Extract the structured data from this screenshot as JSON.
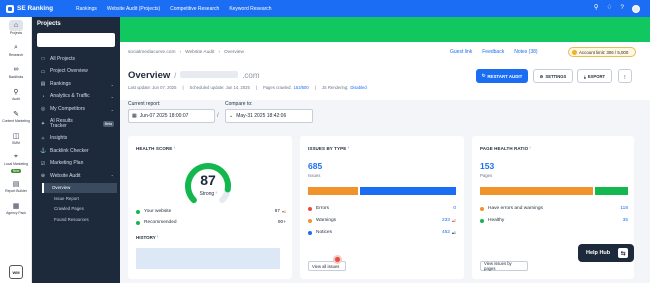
{
  "topbar": {
    "brand": "SE Ranking",
    "nav": [
      "Rankings",
      "Website Audit (Projects)",
      "Competitive Research",
      "Keyword Research"
    ],
    "icons": [
      "location-icon",
      "bell-icon",
      "help-icon",
      "avatar"
    ]
  },
  "rail": [
    {
      "icon": "home-icon",
      "label": "Projects",
      "active": true
    },
    {
      "icon": "search-icon",
      "label": "Research"
    },
    {
      "icon": "link-icon",
      "label": "Backlinks"
    },
    {
      "icon": "magnifier-icon",
      "label": "Audit"
    },
    {
      "icon": "pencil-icon",
      "label": "Content Marketing"
    },
    {
      "icon": "bag-icon",
      "label": "SMM"
    },
    {
      "icon": "pin-icon",
      "label": "Local Marketing",
      "badge": "New"
    },
    {
      "icon": "report-icon",
      "label": "Report Builder"
    },
    {
      "icon": "agency-icon",
      "label": "Agency Pack"
    }
  ],
  "rail_watermark": "WM",
  "projects_panel": {
    "title": "Projects",
    "items": [
      {
        "label": "All Projects",
        "icon": "□"
      },
      {
        "label": "Project Overview",
        "icon": "▭"
      },
      {
        "label": "Rankings",
        "icon": "▤",
        "chevron": true
      },
      {
        "label": "Analytics & Traffic",
        "icon": "◔",
        "chevron": true
      },
      {
        "label": "My Competitors",
        "icon": "◎",
        "chevron": true
      },
      {
        "label": "AI Results Tracker",
        "icon": "✦",
        "beta": "Beta"
      },
      {
        "label": "Insights",
        "icon": "✧"
      },
      {
        "label": "Backlink Checker",
        "icon": "⚓"
      },
      {
        "label": "Marketing Plan",
        "icon": "☑"
      },
      {
        "label": "Website Audit",
        "icon": "⊕",
        "chevron": true
      }
    ],
    "sub_items": [
      "Overview",
      "Issue Report",
      "Crawled Pages",
      "Found Resources"
    ]
  },
  "breadcrumb": [
    "socialmediacurve.com",
    "Website Audit",
    "Overview"
  ],
  "crumb_links": [
    "Guest link",
    "Feedback",
    "Notes (38)"
  ],
  "account_limit": "Account limit: 306 / 5,000",
  "overview": {
    "title": "Overview",
    "suffix": ".com",
    "meta": {
      "last_update": "Last update: Jun 07, 2025",
      "scheduled": "Scheduled update: Jun 14, 2025",
      "pages_crawled_label": "Pages crawled:",
      "pages_crawled": "153/500",
      "js_label": "JS Rendering:",
      "js_value": "Disabled"
    },
    "buttons": {
      "restart": "RESTART AUDIT",
      "settings": "SETTINGS",
      "export": "EXPORT",
      "more": "⋮"
    }
  },
  "report": {
    "current_label": "Current report:",
    "current_value": "Jun-07 2025 18:00:07",
    "compare_label": "Compare to:",
    "compare_value": "May-31 2025 18:42:06"
  },
  "health": {
    "title": "HEALTH SCORE",
    "score": 87,
    "score_text": "Strong",
    "rows": [
      {
        "label": "Your website",
        "value": "87",
        "delta": "▾1",
        "color": "#12b84e"
      },
      {
        "label": "Recommended",
        "value": "90+",
        "delta": "",
        "color": "#12b84e"
      }
    ],
    "history_title": "HISTORY"
  },
  "issues": {
    "title": "ISSUES BY TYPE",
    "total": "685",
    "total_label": "Issues",
    "segments": [
      {
        "label": "Errors",
        "value": 0,
        "color": "#e74c3c"
      },
      {
        "label": "Warnings",
        "value": 233,
        "color": "#f0932b"
      },
      {
        "label": "Notices",
        "value": 452,
        "color": "#1b6ef3"
      }
    ],
    "rows": [
      {
        "label": "Errors",
        "value": "0",
        "delta": "",
        "color": "#e74c3c"
      },
      {
        "label": "Warnings",
        "value": "233",
        "delta": "▴2",
        "color": "#f0932b"
      },
      {
        "label": "Notices",
        "value": "452",
        "delta": "▴1",
        "color": "#1b6ef3"
      }
    ],
    "button": "View all issues"
  },
  "page_health": {
    "title": "PAGE HEALTH RATIO",
    "total": "153",
    "total_label": "Pages",
    "segments": [
      {
        "label": "Have errors and warnings",
        "value": 118,
        "color": "#f0932b"
      },
      {
        "label": "Healthy",
        "value": 35,
        "color": "#12b84e"
      }
    ],
    "rows": [
      {
        "label": "Have errors and warnings",
        "value": "118",
        "color": "#f0932b"
      },
      {
        "label": "Healthy",
        "value": "35",
        "color": "#12b84e"
      }
    ],
    "button": "View issues by pages"
  },
  "help_hub": "Help Hub",
  "colors": {
    "primary": "#1b6ef3",
    "banner": "#10c760",
    "sidebar": "#1d2a3c",
    "gauge_green": "#12b84e"
  }
}
